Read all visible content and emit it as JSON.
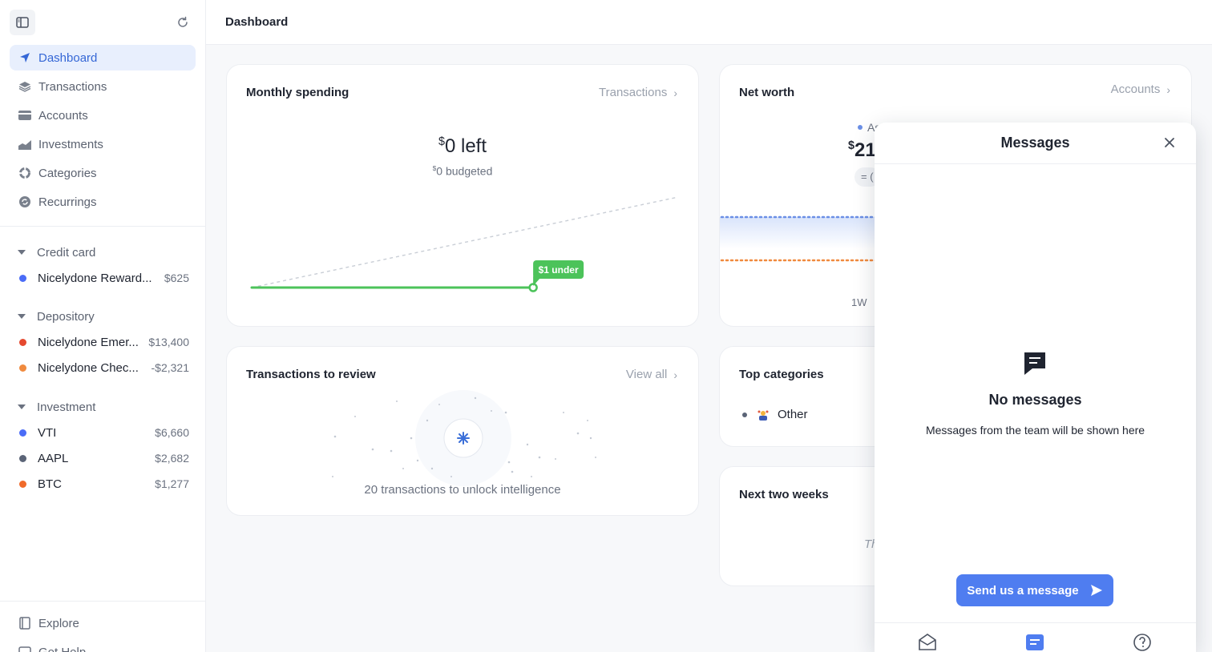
{
  "header": {
    "title": "Dashboard"
  },
  "sidebar": {
    "nav": [
      {
        "label": "Dashboard",
        "icon": "navigation-arrow-icon",
        "active": true
      },
      {
        "label": "Transactions",
        "icon": "layers-icon"
      },
      {
        "label": "Accounts",
        "icon": "card-icon"
      },
      {
        "label": "Investments",
        "icon": "chart-area-icon"
      },
      {
        "label": "Categories",
        "icon": "pie-ring-icon"
      },
      {
        "label": "Recurrings",
        "icon": "recurring-icon"
      }
    ],
    "groups": [
      {
        "label": "Credit card",
        "accounts": [
          {
            "name": "Nicelydone Reward...",
            "amount": "$625",
            "color": "#4a6cf7"
          }
        ]
      },
      {
        "label": "Depository",
        "accounts": [
          {
            "name": "Nicelydone Emer...",
            "amount": "$13,400",
            "color": "#e5492f"
          },
          {
            "name": "Nicelydone Chec...",
            "amount": "-$2,321",
            "color": "#f08a3e"
          }
        ]
      },
      {
        "label": "Investment",
        "accounts": [
          {
            "name": "VTI",
            "amount": "$6,660",
            "color": "#4a6cf7"
          },
          {
            "name": "AAPL",
            "amount": "$2,682",
            "color": "#5b6477"
          },
          {
            "name": "BTC",
            "amount": "$1,277",
            "color": "#f06a2a"
          }
        ]
      }
    ],
    "bottom": [
      {
        "label": "Explore",
        "icon": "book-icon"
      },
      {
        "label": "Get Help",
        "icon": "help-icon"
      }
    ]
  },
  "monthly_spending": {
    "title": "Monthly spending",
    "link": "Transactions",
    "left_amount": "0 left",
    "currency": "$",
    "budgeted": "0 budgeted",
    "badge": "$1 under",
    "spent_progress": 0.66
  },
  "net_worth": {
    "title": "Net worth",
    "link": "Accounts",
    "legend_partial": "As",
    "amount_partial": "21",
    "equals_partial": "= (",
    "range_label": "1W"
  },
  "review": {
    "title": "Transactions to review",
    "link": "View all",
    "message": "20 transactions to unlock intelligence"
  },
  "top_categories": {
    "title": "Top categories",
    "items": [
      {
        "label": "Other"
      }
    ]
  },
  "next_two_weeks": {
    "title": "Next two weeks",
    "partial_text": "Th"
  },
  "messages": {
    "title": "Messages",
    "empty_title": "No messages",
    "empty_subtitle": "Messages from the team will be shown here",
    "cta": "Send us a message",
    "accent": "#4f7df0"
  }
}
